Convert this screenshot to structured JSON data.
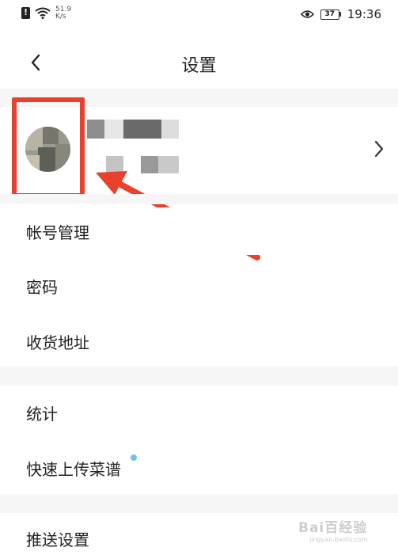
{
  "status_bar": {
    "net_speed_value": "51.9",
    "net_speed_unit": "K/s",
    "battery_level": "37",
    "time": "19:36"
  },
  "header": {
    "title": "设置"
  },
  "menu": {
    "group1": [
      "帐号管理",
      "密码",
      "收货地址"
    ],
    "group2": [
      "统计",
      "快速上传菜谱"
    ],
    "group3": [
      "推送设置"
    ]
  },
  "watermark": {
    "brand": "Bai百经验",
    "site": "jingyan.baidu.com"
  },
  "colors": {
    "highlight": "#e8412e",
    "badge_dot": "#6dc3e6",
    "section_gap": "#f6f6f6"
  },
  "icons": [
    "sim-alert-icon",
    "wifi-icon",
    "eye-icon",
    "battery-icon",
    "back-arrow-icon",
    "chevron-right-icon",
    "annotation-arrow-icon"
  ]
}
